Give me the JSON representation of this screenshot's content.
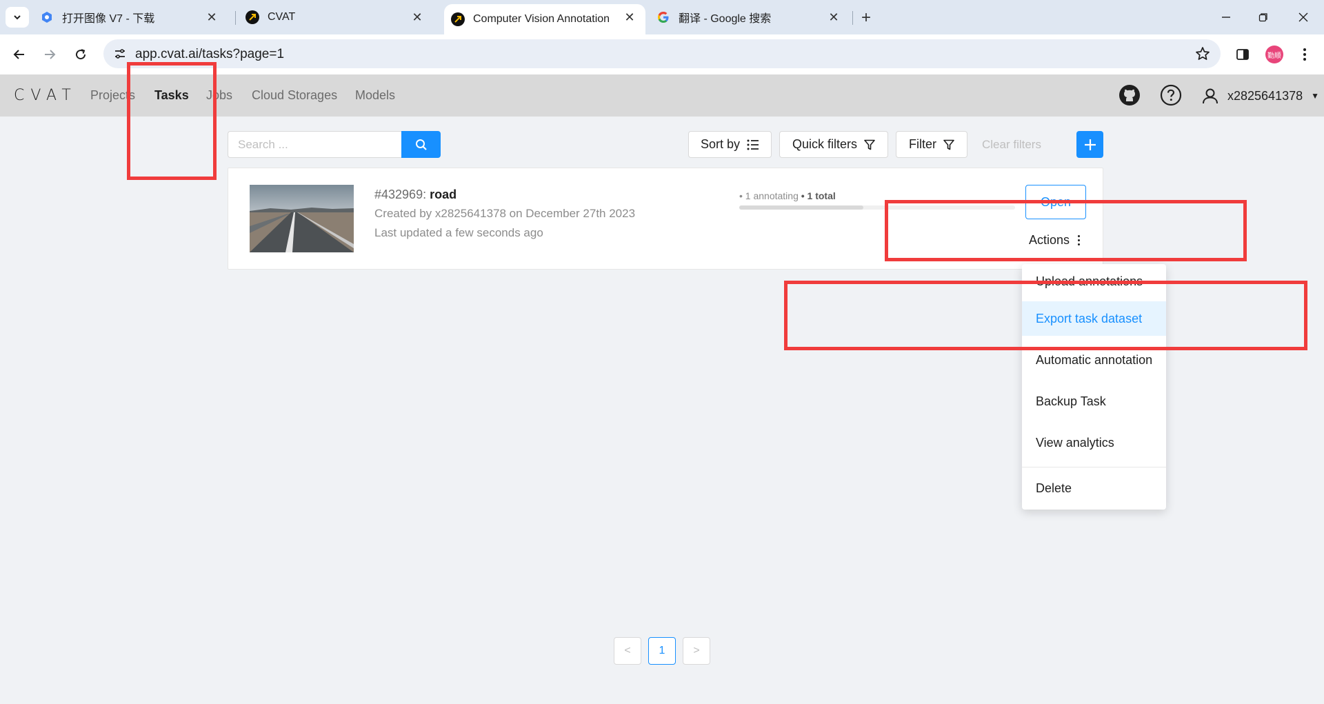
{
  "browser": {
    "tabs": [
      {
        "title": "打开图像 V7 - 下载",
        "active": false
      },
      {
        "title": "CVAT",
        "active": false
      },
      {
        "title": "Computer Vision Annotation",
        "active": true
      },
      {
        "title": "翻译 - Google 搜索",
        "active": false
      }
    ],
    "url": "app.cvat.ai/tasks?page=1",
    "profile_label": "勤顺"
  },
  "header": {
    "logo": "CVAT",
    "nav": [
      {
        "label": "Projects",
        "active": false
      },
      {
        "label": "Tasks",
        "active": true
      },
      {
        "label": "Jobs",
        "active": false
      },
      {
        "label": "Cloud Storages",
        "active": false
      },
      {
        "label": "Models",
        "active": false
      }
    ],
    "username": "x2825641378"
  },
  "toolbar": {
    "search_placeholder": "Search ...",
    "sort_label": "Sort by",
    "quick_filters_label": "Quick filters",
    "filter_label": "Filter",
    "clear_filters_label": "Clear filters"
  },
  "task": {
    "id": "#432969:",
    "name": "road",
    "created": "Created by x2825641378 on December 27th 2023",
    "updated": "Last updated a few seconds ago",
    "progress_annotating": "• 1 annotating",
    "progress_total": "• 1 total",
    "progress_fraction": 0.45,
    "open_label": "Open",
    "actions_label": "Actions"
  },
  "actions_menu": {
    "items": [
      {
        "label": "Upload annotations",
        "active": false
      },
      {
        "label": "Export task dataset",
        "active": true
      },
      {
        "label": "Automatic annotation",
        "active": false
      },
      {
        "label": "Backup Task",
        "active": false
      },
      {
        "label": "View analytics",
        "active": false
      },
      {
        "label": "Delete",
        "active": false
      }
    ]
  },
  "pagination": {
    "prev": "<",
    "current": "1",
    "next": ">"
  },
  "colors": {
    "primary": "#1890ff",
    "annotation_red": "#f03c3c",
    "header_bg": "#d9d9d9"
  }
}
